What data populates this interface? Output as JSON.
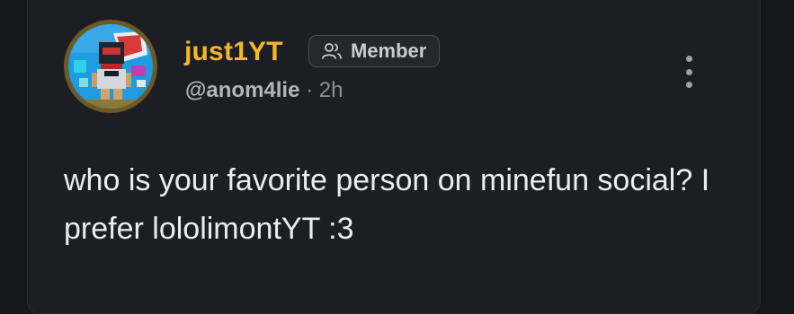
{
  "post": {
    "author": {
      "display_name": "just1YT",
      "name_color": "#f4b62a",
      "handle": "@anom4lie",
      "avatar_icon": "minecraft-skin-avatar"
    },
    "badge": {
      "label": "Member",
      "icon": "users-icon"
    },
    "timestamp": "2h",
    "separator": "·",
    "menu_icon": "more-vertical-icon",
    "text": "who is your favorite person on minefun social? I prefer lololimontYT :3"
  }
}
